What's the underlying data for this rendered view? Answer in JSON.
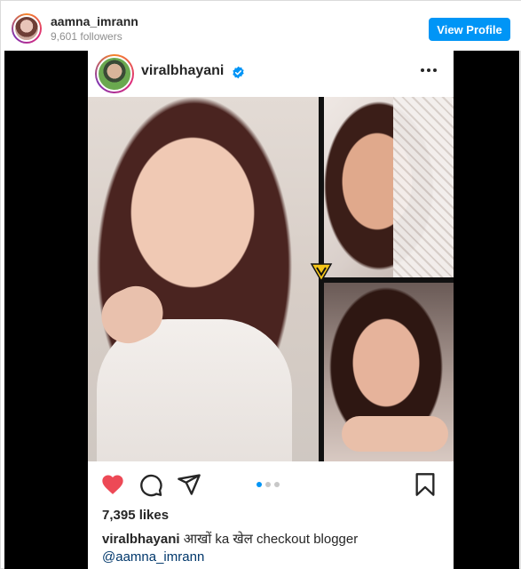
{
  "embed": {
    "username": "aamna_imrann",
    "followers": "9,601 followers",
    "view_profile_label": "View Profile",
    "accent_color": "#0095f6"
  },
  "post": {
    "username": "viralbhayani",
    "verified": true,
    "more_icon": "more-horizontal-icon",
    "carousel": {
      "total": 3,
      "active_index": 0
    },
    "likes": "7,395 likes",
    "caption": {
      "username": "viralbhayani",
      "text": " आखों ka खेल checkout blogger ",
      "mention": "@aamna_imrann"
    },
    "icons": {
      "like": "heart-filled-icon",
      "comment": "comment-icon",
      "share": "send-icon",
      "save": "bookmark-icon"
    },
    "like_color": "#ed4956"
  }
}
